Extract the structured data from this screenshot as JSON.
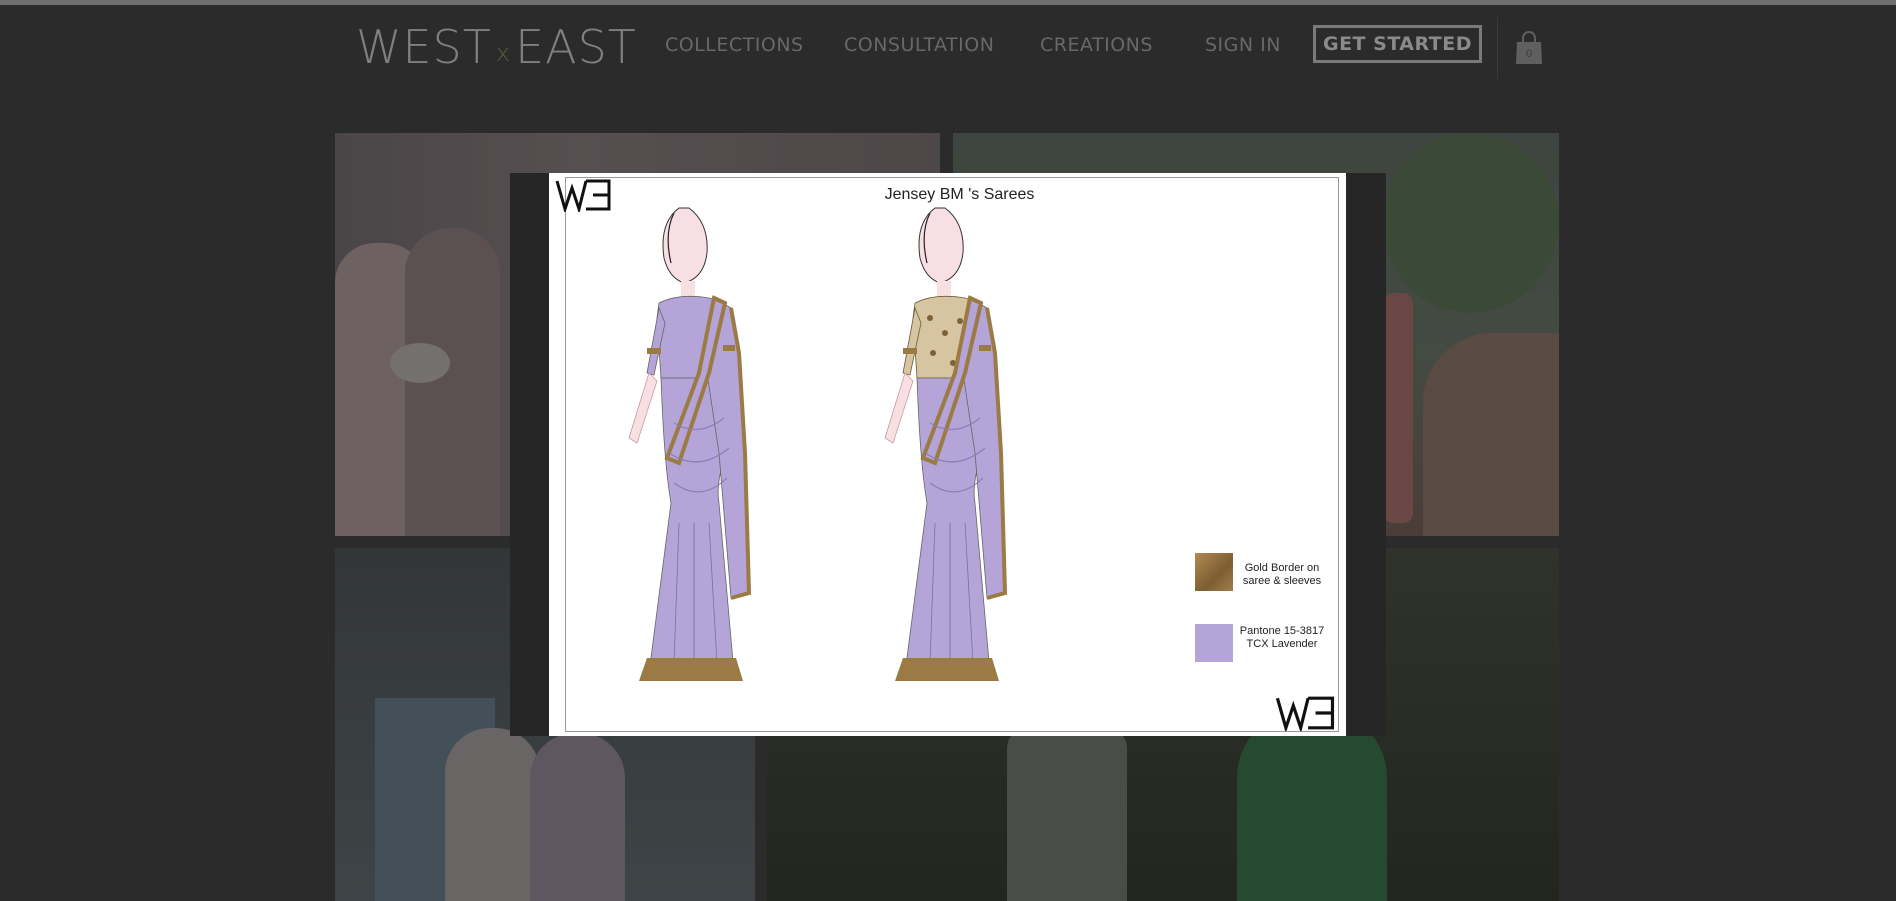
{
  "header": {
    "logo": {
      "left": "WEST",
      "mid": "x",
      "right": "EAST"
    },
    "nav": [
      {
        "label": "COLLECTIONS"
      },
      {
        "label": "CONSULTATION"
      },
      {
        "label": "CREATIONS"
      },
      {
        "label": "SIGN IN"
      }
    ],
    "cta_label": "GET STARTED",
    "cart_count": "0"
  },
  "lightbox": {
    "title": "Jensey BM 's Sarees",
    "brand_mark": "WE",
    "legend": [
      {
        "label": "Gold Border on saree & sleeves",
        "color": "#9b7a44"
      },
      {
        "label": "Pantone 15-3817 TCX Lavender",
        "color": "#b4a4d8"
      }
    ]
  },
  "colors": {
    "page_bg": "#2b2b2b",
    "saree_lavender": "#b4a4d8",
    "gold_border": "#9b7a44"
  }
}
